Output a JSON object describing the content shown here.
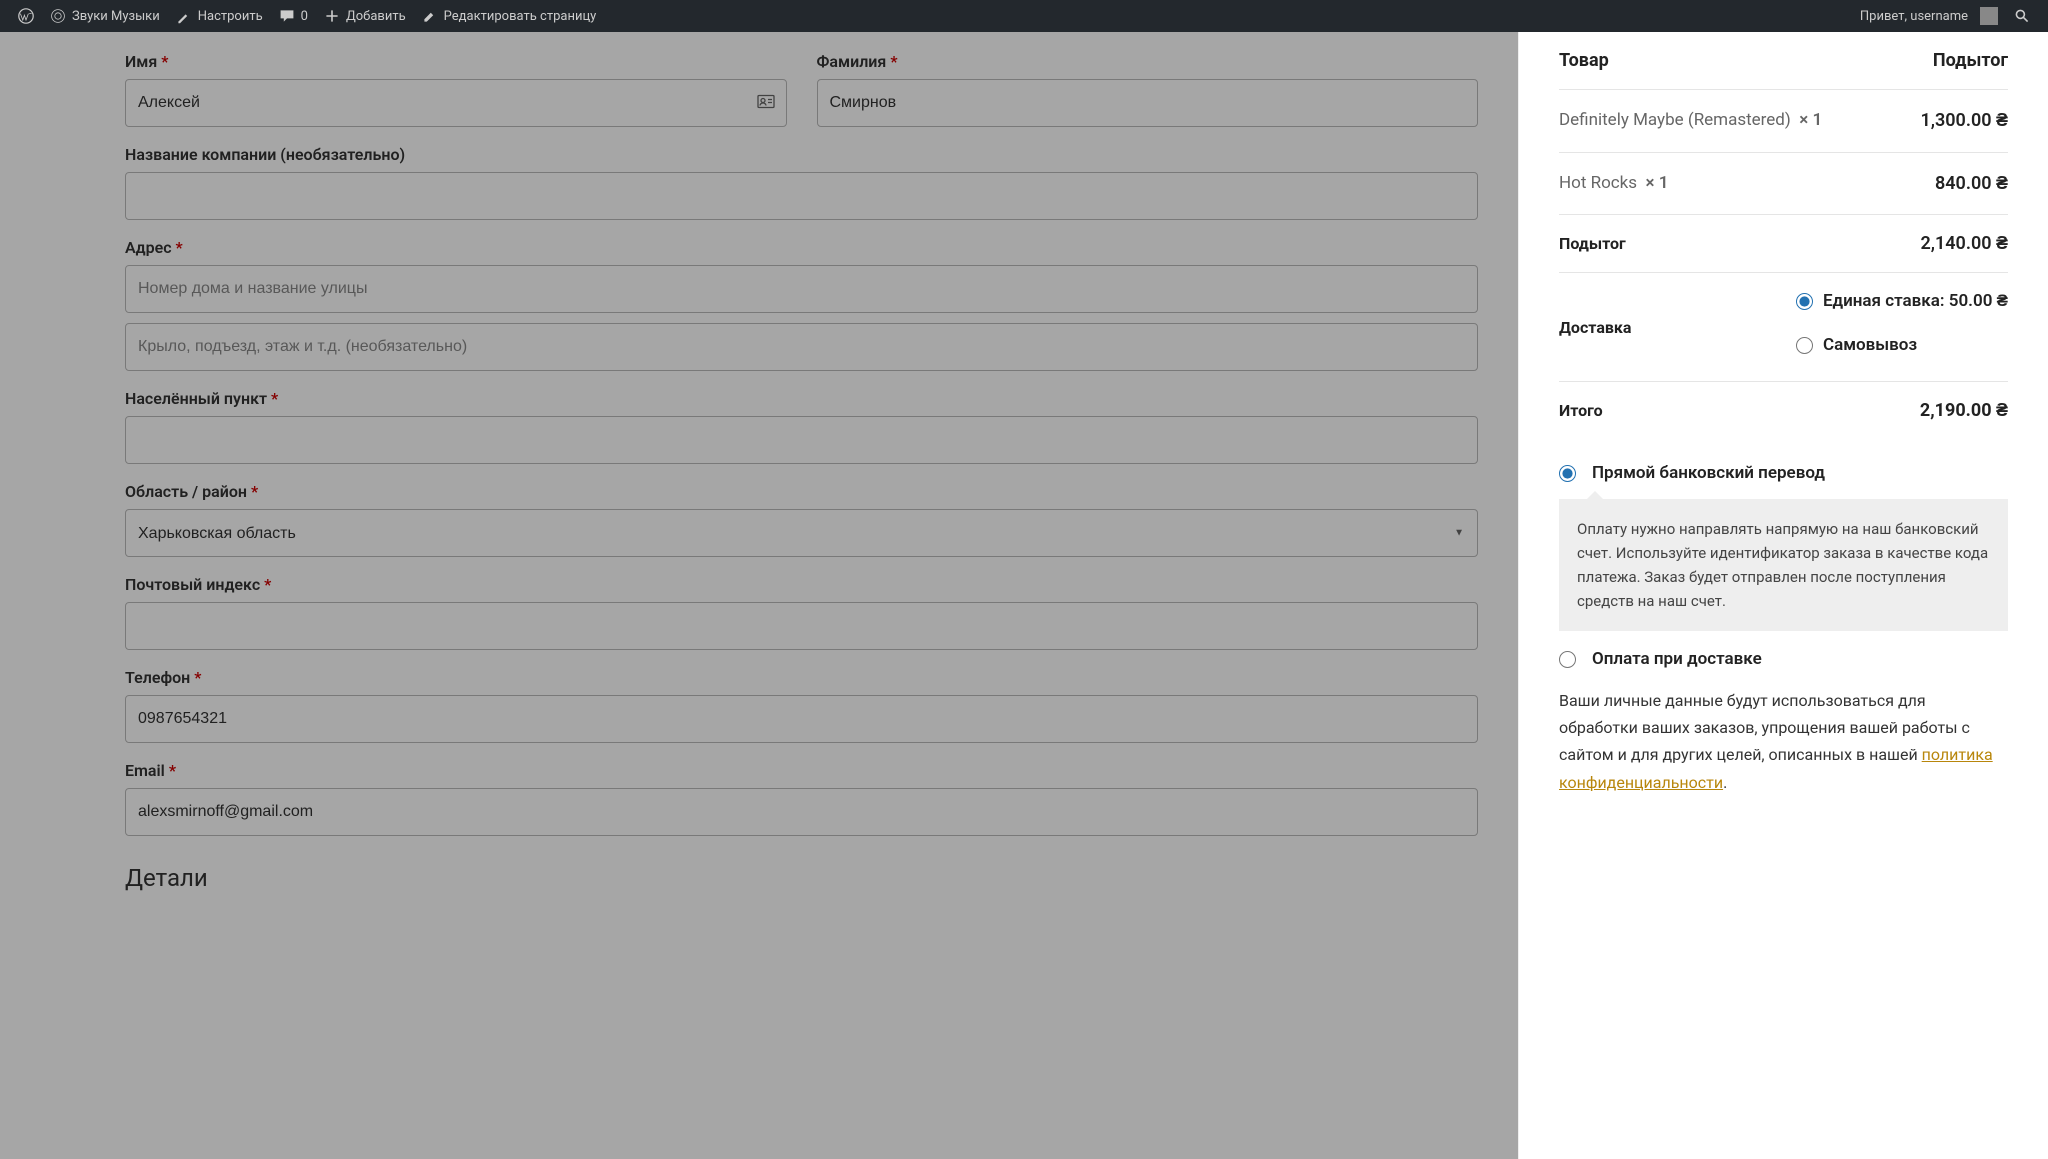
{
  "wpbar": {
    "site": "Звуки Музыки",
    "customize": "Настроить",
    "comments": "0",
    "add": "Добавить",
    "edit": "Редактировать страницу",
    "greeting": "Привет, username"
  },
  "form": {
    "first_name": {
      "label": "Имя",
      "value": "Алексей"
    },
    "last_name": {
      "label": "Фамилия",
      "value": "Смирнов"
    },
    "company": {
      "label": "Название компании (необязательно)",
      "value": ""
    },
    "address": {
      "label": "Адрес",
      "ph1": "Номер дома и название улицы",
      "ph2": "Крыло, подъезд, этаж и т.д. (необязательно)"
    },
    "city": {
      "label": "Населённый пункт",
      "value": ""
    },
    "region": {
      "label": "Область / район",
      "value": "Харьковская область"
    },
    "postcode": {
      "label": "Почтовый индекс",
      "value": ""
    },
    "phone": {
      "label": "Телефон",
      "value": "0987654321"
    },
    "email": {
      "label": "Email",
      "value": "alexsmirnoff@gmail.com"
    },
    "details_heading": "Детали"
  },
  "order": {
    "head_product": "Товар",
    "head_subtotal": "Подытог",
    "items": [
      {
        "name": "Definitely Maybe (Remastered)",
        "qty": "× 1",
        "price": "1,300.00 ₴"
      },
      {
        "name": "Hot Rocks",
        "qty": "× 1",
        "price": "840.00 ₴"
      }
    ],
    "subtotal_label": "Подытог",
    "subtotal": "2,140.00 ₴",
    "shipping_label": "Доставка",
    "shipping_options": [
      {
        "label": "Единая ставка: 50.00 ₴",
        "checked": true
      },
      {
        "label": "Самовывоз",
        "checked": false
      }
    ],
    "total_label": "Итого",
    "total": "2,190.00 ₴"
  },
  "payment": {
    "options": [
      {
        "label": "Прямой банковский перевод",
        "checked": true,
        "desc": "Оплату нужно направлять напрямую на наш банковский счет. Используйте идентификатор заказа в качестве кода платежа. Заказ будет отправлен после поступления средств на наш счет."
      },
      {
        "label": "Оплата при доставке",
        "checked": false
      }
    ]
  },
  "privacy": {
    "text": "Ваши личные данные будут использоваться для обработки ваших заказов, упрощения вашей работы с сайтом и для других целей, описанных в нашей ",
    "link": "политика конфиденциальности"
  }
}
